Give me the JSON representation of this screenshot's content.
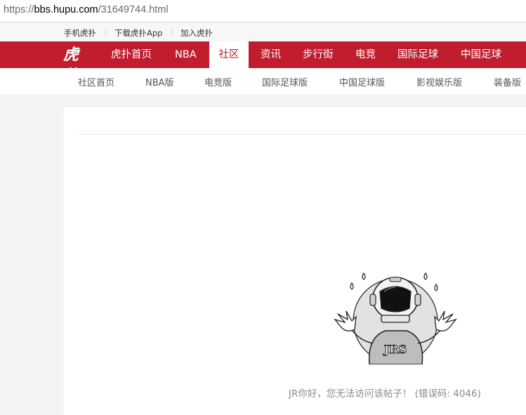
{
  "browser": {
    "url_scheme": "https://",
    "url_host": "bbs.hupu.com",
    "url_path": "/31649744.html"
  },
  "topbar": {
    "links": [
      "手机虎扑",
      "下载虎扑App",
      "加入虎扑"
    ]
  },
  "mainnav": {
    "logo_text": "虎扑",
    "items": [
      "虎扑首页",
      "NBA",
      "社区",
      "资讯",
      "步行街",
      "电竞",
      "国际足球",
      "中国足球"
    ],
    "active": "社区",
    "colors": {
      "brand": "#c01e2f",
      "active_bg": "#ffffff"
    }
  },
  "subnav": {
    "items": [
      "社区首页",
      "NBA版",
      "电竞版",
      "国际足球版",
      "中国足球版",
      "影视娱乐版",
      "装备版"
    ]
  },
  "main": {
    "mascot_badge": "JRS",
    "error_message": "JR你好，您无法访问该帖子！ (错误码: 4046)"
  }
}
